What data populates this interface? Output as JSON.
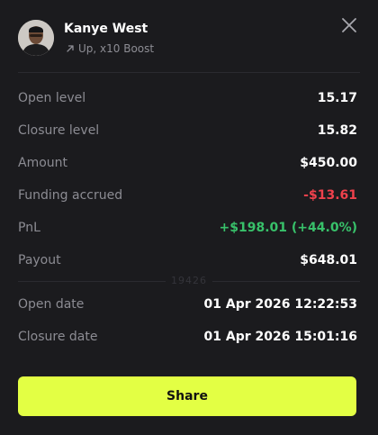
{
  "header": {
    "title": "Kanye West",
    "subtitle": "Up, x10 Boost",
    "avatar_icon": "portrait-avatar",
    "direction_icon": "arrow-up-right-icon",
    "close_icon": "close-icon"
  },
  "details": [
    {
      "label": "Open level",
      "value": "15.17",
      "tone": "neutral"
    },
    {
      "label": "Closure level",
      "value": "15.82",
      "tone": "neutral"
    },
    {
      "label": "Amount",
      "value": "$450.00",
      "tone": "neutral"
    },
    {
      "label": "Funding accrued",
      "value": "-$13.61",
      "tone": "negative"
    },
    {
      "label": "PnL",
      "value": "+$198.01 (+44.0%)",
      "tone": "positive"
    },
    {
      "label": "Payout",
      "value": "$648.01",
      "tone": "neutral"
    }
  ],
  "watermark": "19426",
  "dates": [
    {
      "label": "Open date",
      "value": "01 Apr 2026 12:22:53"
    },
    {
      "label": "Closure date",
      "value": "01 Apr 2026 15:01:16"
    }
  ],
  "share_label": "Share",
  "colors": {
    "background": "#1b1b1e",
    "accent": "#e3ff44",
    "negative": "#f0414c",
    "positive": "#38c16a",
    "muted": "#8c8c93"
  }
}
